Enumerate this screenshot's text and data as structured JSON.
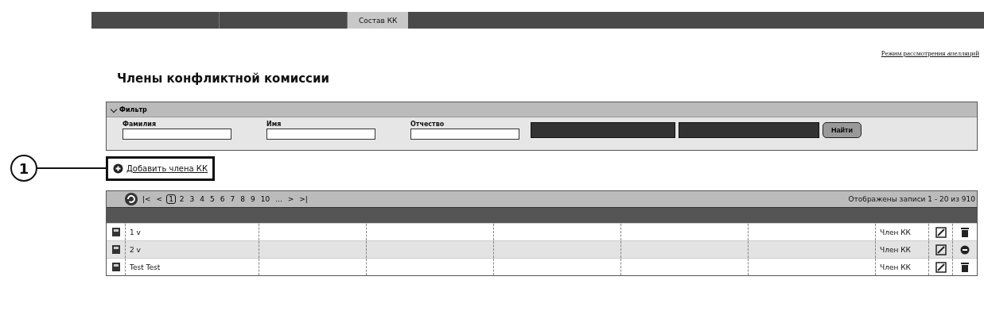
{
  "nav_tabs": [
    {
      "label": "Состав КК",
      "selected": true
    }
  ],
  "top_link": "Режим рассмотрения апелляций",
  "title": "Члены конфликтной комиссии",
  "filter": {
    "title": "Фильтр",
    "expanded": true,
    "fields": [
      {
        "label": "Фамилия"
      },
      {
        "label": "Имя"
      },
      {
        "label": "Отчество"
      }
    ],
    "find_button": "Найти"
  },
  "callout": "1",
  "add_link": "Добавить члена КК",
  "pager": {
    "first": "|<",
    "prev": "<",
    "pages": [
      {
        "label": "1",
        "selected": true
      },
      {
        "label": "2",
        "selected": false
      },
      {
        "label": "3",
        "selected": false
      },
      {
        "label": "4",
        "selected": false
      },
      {
        "label": "5",
        "selected": false
      },
      {
        "label": "6",
        "selected": false
      },
      {
        "label": "7",
        "selected": false
      },
      {
        "label": "8",
        "selected": false
      },
      {
        "label": "9",
        "selected": false
      },
      {
        "label": "10",
        "selected": false
      }
    ],
    "more": "...",
    "next": ">",
    "last": ">|",
    "summary": "Отображены записи 1 - 20 из 910"
  },
  "rows": [
    {
      "name": "1 v",
      "role": "Член КК",
      "selected": false,
      "action": {
        "kind": "delete"
      }
    },
    {
      "name": "2 v",
      "role": "Член КК",
      "selected": true,
      "action": {
        "kind": "remove"
      }
    },
    {
      "name": "Test Test",
      "role": "Член КК",
      "selected": false,
      "action": {
        "kind": "delete"
      }
    }
  ]
}
